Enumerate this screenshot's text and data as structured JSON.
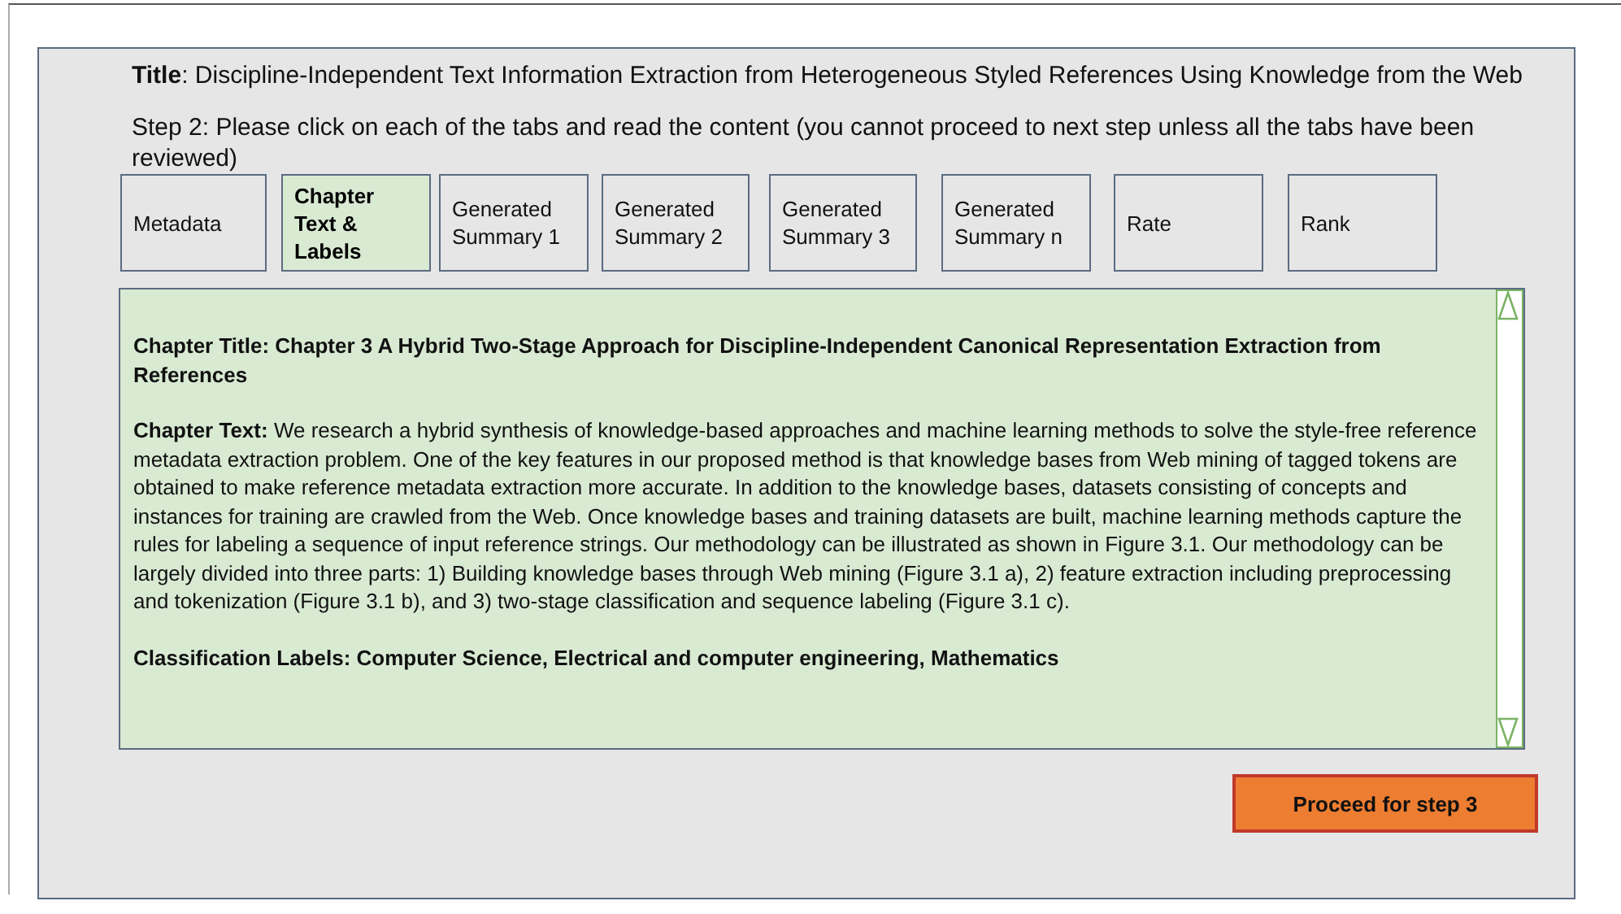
{
  "title": "**Title**: Discipline-Independent Text Information Extraction from Heterogeneous Styled References Using Knowledge from the Web",
  "instruction": "Step 2: Please click on each of the tabs and read the content (you cannot proceed to next step unless all the tabs have been reviewed)",
  "tabs": [
    {
      "label": "Metadata",
      "selected": false
    },
    {
      "label": "Chapter Text & Labels",
      "selected": true
    },
    {
      "label": "Generated Summary 1",
      "selected": false
    },
    {
      "label": "Generated Summary 2",
      "selected": false
    },
    {
      "label": "Generated Summary 3",
      "selected": false
    },
    {
      "label": "Generated Summary n",
      "selected": false
    },
    {
      "label": "Rate",
      "selected": false
    },
    {
      "label": "Rank",
      "selected": false
    }
  ],
  "content": {
    "chapter_title": "Chapter Title: Chapter 3 A Hybrid Two-Stage Approach for Discipline-Independent Canonical Representation Extraction from References",
    "chapter_text": "**Chapter Text:** We research a hybrid synthesis of knowledge-based approaches and machine learning methods to solve the style-free reference metadata extraction problem. One of the key features in our proposed method is that knowledge bases from Web mining of tagged tokens are obtained to make reference metadata extraction more accurate. In addition to the knowledge bases, datasets consisting of concepts and instances for training are crawled from the Web. Once knowledge bases and training datasets are built, machine learning methods capture the rules for labeling a sequence of input reference strings. Our methodology can be illustrated as shown in Figure 3.1. Our methodology can be largely divided into three parts: 1) Building knowledge bases through Web mining (Figure 3.1 a), 2) feature extraction including preprocessing and tokenization (Figure 3.1 b), and 3) two-stage classification and sequence labeling (Figure 3.1 c).",
    "classification_labels": "Classification Labels: Computer Science, Electrical and computer engineering, Mathematics"
  },
  "proceed_button": "Proceed for step 3"
}
